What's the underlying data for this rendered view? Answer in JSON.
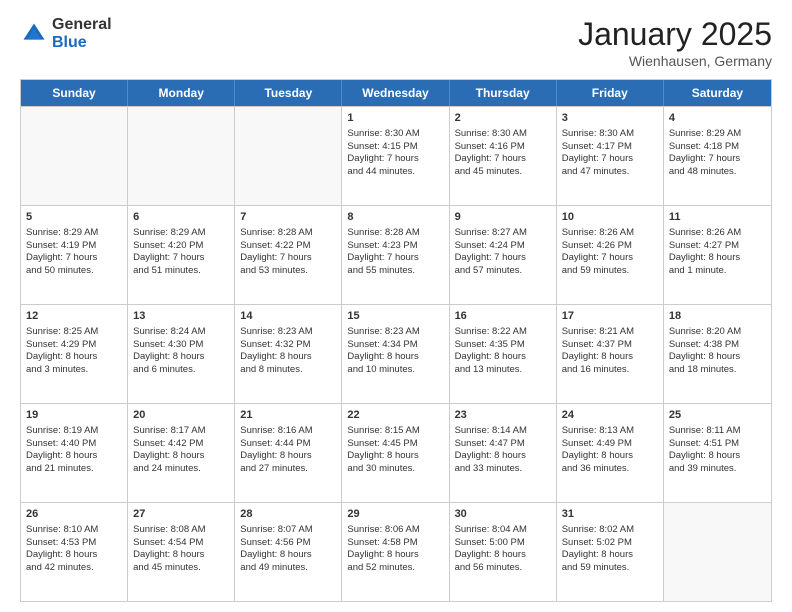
{
  "logo": {
    "general": "General",
    "blue": "Blue"
  },
  "title": "January 2025",
  "location": "Wienhausen, Germany",
  "days": [
    "Sunday",
    "Monday",
    "Tuesday",
    "Wednesday",
    "Thursday",
    "Friday",
    "Saturday"
  ],
  "rows": [
    [
      {
        "day": "",
        "info": "",
        "empty": true
      },
      {
        "day": "",
        "info": "",
        "empty": true
      },
      {
        "day": "",
        "info": "",
        "empty": true
      },
      {
        "day": "1",
        "info": "Sunrise: 8:30 AM\nSunset: 4:15 PM\nDaylight: 7 hours\nand 44 minutes."
      },
      {
        "day": "2",
        "info": "Sunrise: 8:30 AM\nSunset: 4:16 PM\nDaylight: 7 hours\nand 45 minutes."
      },
      {
        "day": "3",
        "info": "Sunrise: 8:30 AM\nSunset: 4:17 PM\nDaylight: 7 hours\nand 47 minutes."
      },
      {
        "day": "4",
        "info": "Sunrise: 8:29 AM\nSunset: 4:18 PM\nDaylight: 7 hours\nand 48 minutes."
      }
    ],
    [
      {
        "day": "5",
        "info": "Sunrise: 8:29 AM\nSunset: 4:19 PM\nDaylight: 7 hours\nand 50 minutes."
      },
      {
        "day": "6",
        "info": "Sunrise: 8:29 AM\nSunset: 4:20 PM\nDaylight: 7 hours\nand 51 minutes."
      },
      {
        "day": "7",
        "info": "Sunrise: 8:28 AM\nSunset: 4:22 PM\nDaylight: 7 hours\nand 53 minutes."
      },
      {
        "day": "8",
        "info": "Sunrise: 8:28 AM\nSunset: 4:23 PM\nDaylight: 7 hours\nand 55 minutes."
      },
      {
        "day": "9",
        "info": "Sunrise: 8:27 AM\nSunset: 4:24 PM\nDaylight: 7 hours\nand 57 minutes."
      },
      {
        "day": "10",
        "info": "Sunrise: 8:26 AM\nSunset: 4:26 PM\nDaylight: 7 hours\nand 59 minutes."
      },
      {
        "day": "11",
        "info": "Sunrise: 8:26 AM\nSunset: 4:27 PM\nDaylight: 8 hours\nand 1 minute."
      }
    ],
    [
      {
        "day": "12",
        "info": "Sunrise: 8:25 AM\nSunset: 4:29 PM\nDaylight: 8 hours\nand 3 minutes."
      },
      {
        "day": "13",
        "info": "Sunrise: 8:24 AM\nSunset: 4:30 PM\nDaylight: 8 hours\nand 6 minutes."
      },
      {
        "day": "14",
        "info": "Sunrise: 8:23 AM\nSunset: 4:32 PM\nDaylight: 8 hours\nand 8 minutes."
      },
      {
        "day": "15",
        "info": "Sunrise: 8:23 AM\nSunset: 4:34 PM\nDaylight: 8 hours\nand 10 minutes."
      },
      {
        "day": "16",
        "info": "Sunrise: 8:22 AM\nSunset: 4:35 PM\nDaylight: 8 hours\nand 13 minutes."
      },
      {
        "day": "17",
        "info": "Sunrise: 8:21 AM\nSunset: 4:37 PM\nDaylight: 8 hours\nand 16 minutes."
      },
      {
        "day": "18",
        "info": "Sunrise: 8:20 AM\nSunset: 4:38 PM\nDaylight: 8 hours\nand 18 minutes."
      }
    ],
    [
      {
        "day": "19",
        "info": "Sunrise: 8:19 AM\nSunset: 4:40 PM\nDaylight: 8 hours\nand 21 minutes."
      },
      {
        "day": "20",
        "info": "Sunrise: 8:17 AM\nSunset: 4:42 PM\nDaylight: 8 hours\nand 24 minutes."
      },
      {
        "day": "21",
        "info": "Sunrise: 8:16 AM\nSunset: 4:44 PM\nDaylight: 8 hours\nand 27 minutes."
      },
      {
        "day": "22",
        "info": "Sunrise: 8:15 AM\nSunset: 4:45 PM\nDaylight: 8 hours\nand 30 minutes."
      },
      {
        "day": "23",
        "info": "Sunrise: 8:14 AM\nSunset: 4:47 PM\nDaylight: 8 hours\nand 33 minutes."
      },
      {
        "day": "24",
        "info": "Sunrise: 8:13 AM\nSunset: 4:49 PM\nDaylight: 8 hours\nand 36 minutes."
      },
      {
        "day": "25",
        "info": "Sunrise: 8:11 AM\nSunset: 4:51 PM\nDaylight: 8 hours\nand 39 minutes."
      }
    ],
    [
      {
        "day": "26",
        "info": "Sunrise: 8:10 AM\nSunset: 4:53 PM\nDaylight: 8 hours\nand 42 minutes."
      },
      {
        "day": "27",
        "info": "Sunrise: 8:08 AM\nSunset: 4:54 PM\nDaylight: 8 hours\nand 45 minutes."
      },
      {
        "day": "28",
        "info": "Sunrise: 8:07 AM\nSunset: 4:56 PM\nDaylight: 8 hours\nand 49 minutes."
      },
      {
        "day": "29",
        "info": "Sunrise: 8:06 AM\nSunset: 4:58 PM\nDaylight: 8 hours\nand 52 minutes."
      },
      {
        "day": "30",
        "info": "Sunrise: 8:04 AM\nSunset: 5:00 PM\nDaylight: 8 hours\nand 56 minutes."
      },
      {
        "day": "31",
        "info": "Sunrise: 8:02 AM\nSunset: 5:02 PM\nDaylight: 8 hours\nand 59 minutes."
      },
      {
        "day": "",
        "info": "",
        "empty": true
      }
    ]
  ]
}
